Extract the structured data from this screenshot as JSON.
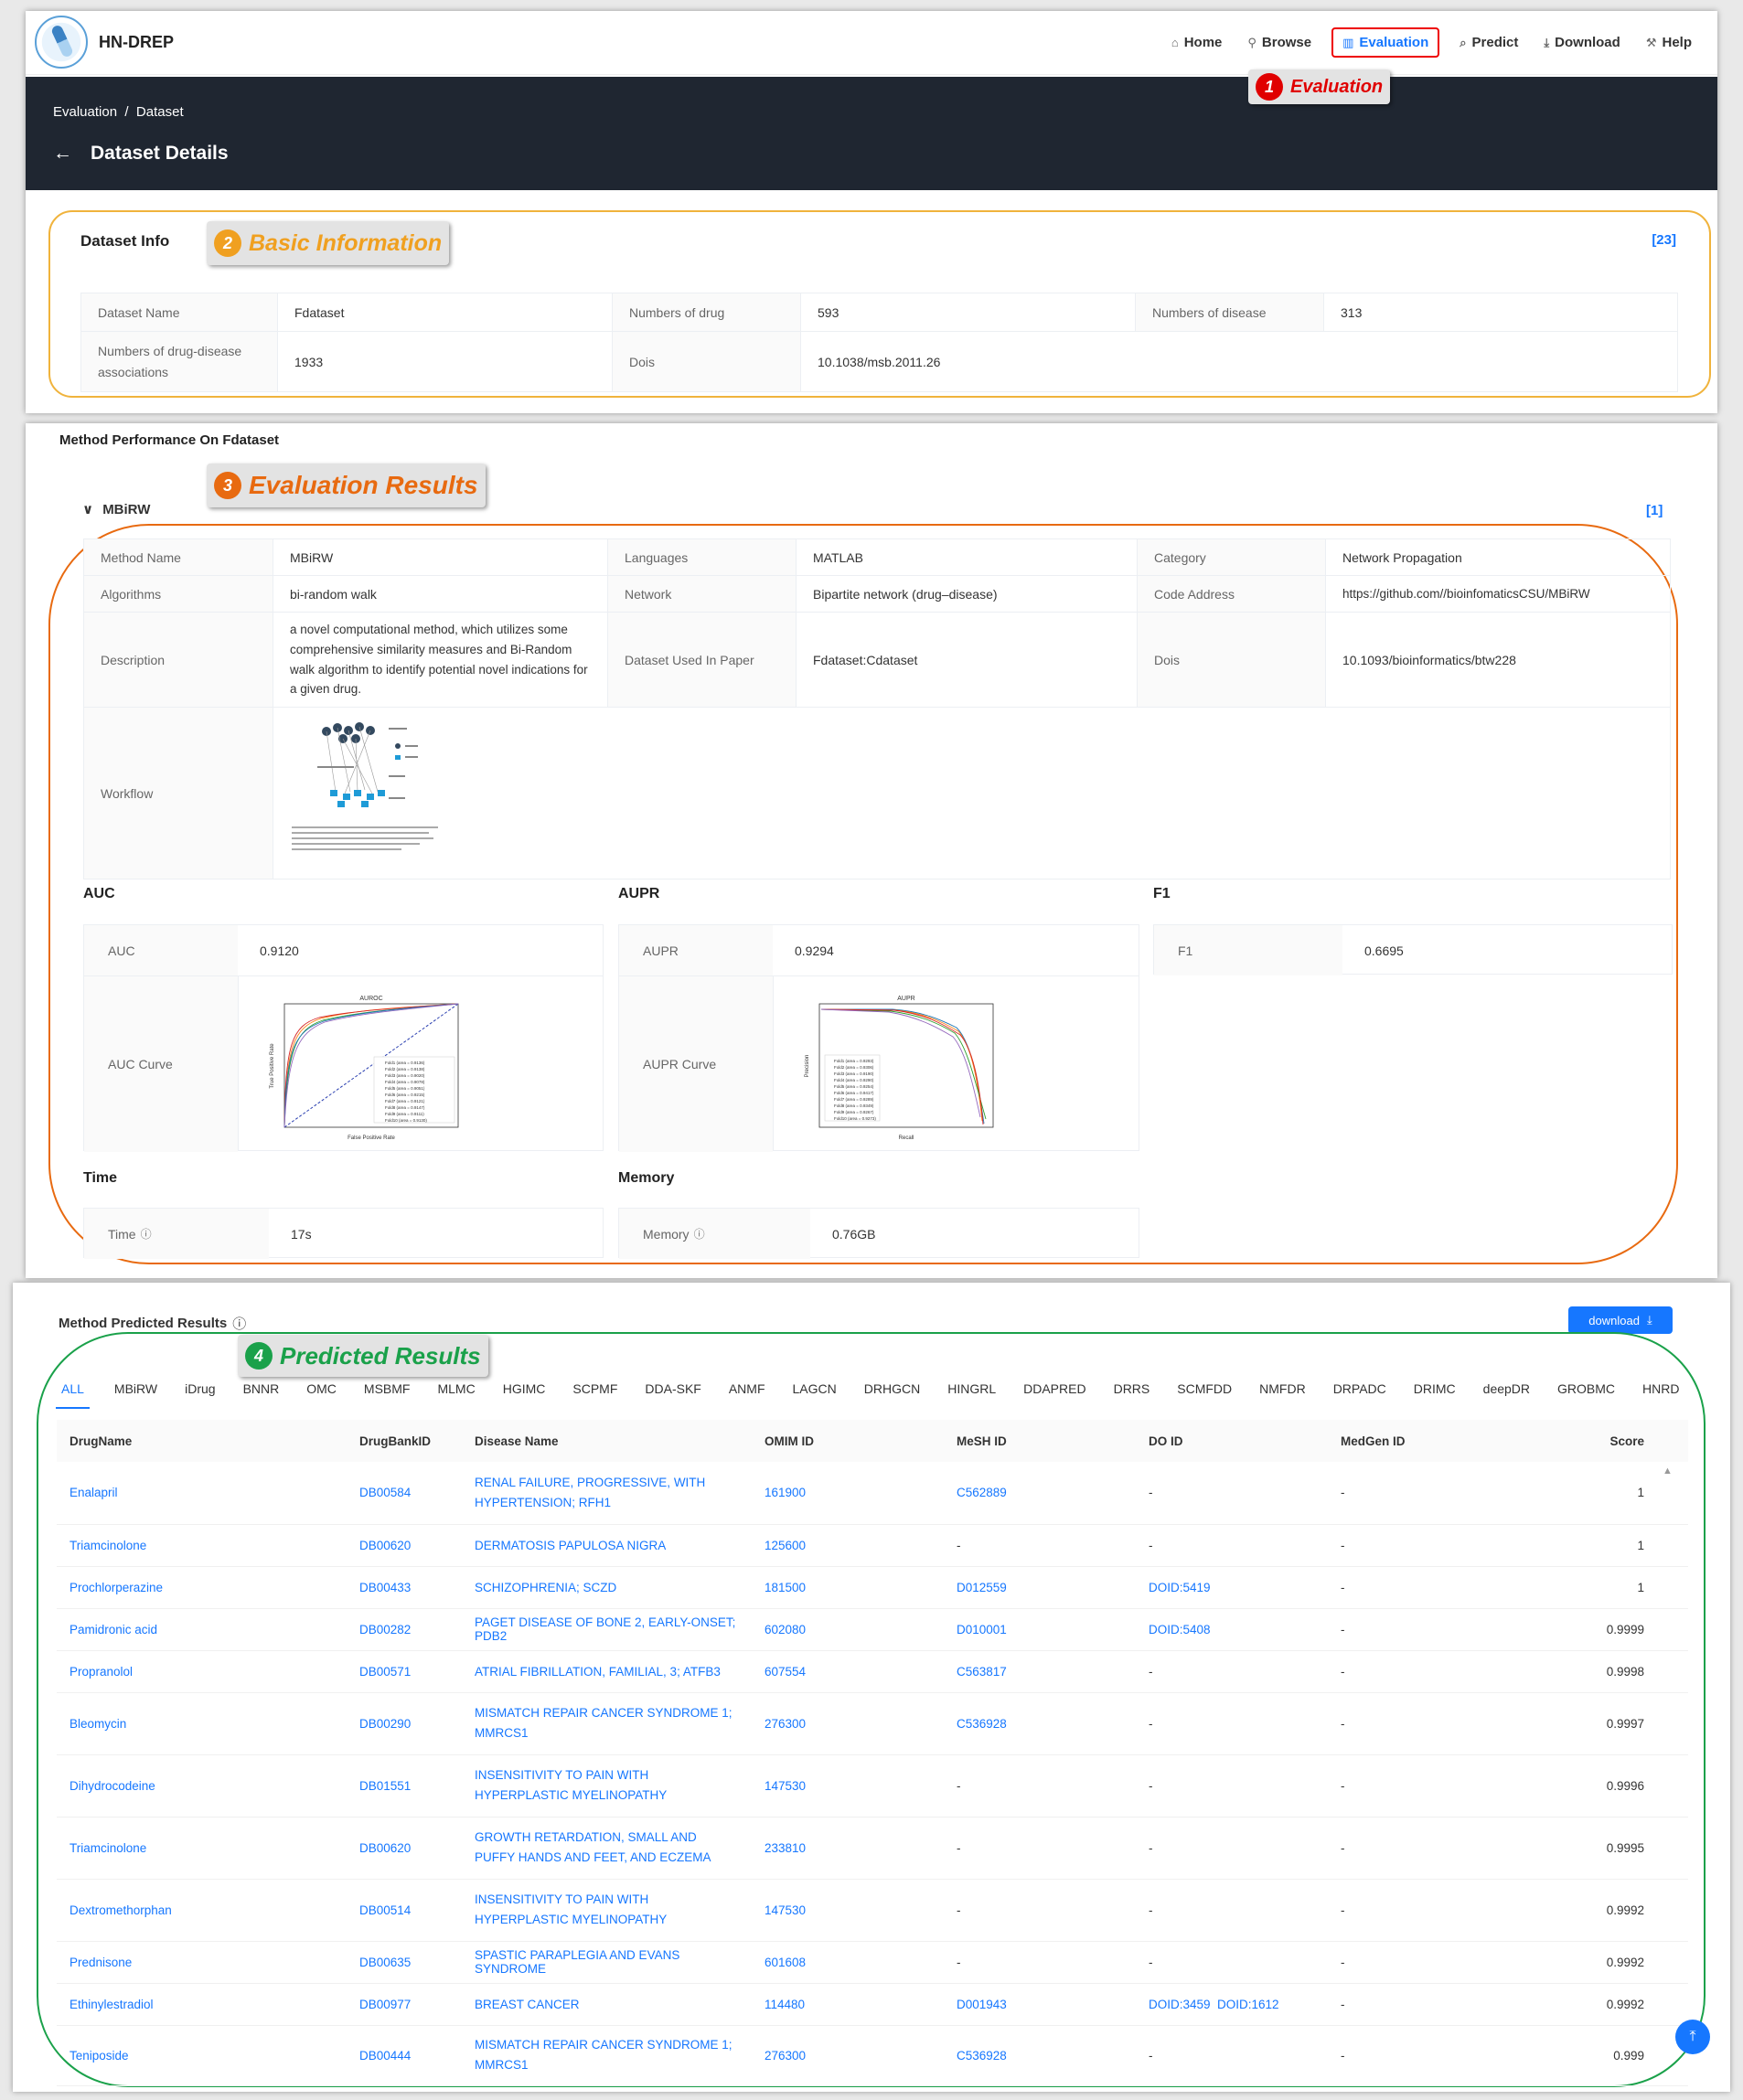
{
  "brand": "HN-DREP",
  "nav": [
    {
      "label": "Home",
      "icon": "home-icon"
    },
    {
      "label": "Browse",
      "icon": "browse-icon"
    },
    {
      "label": "Evaluation",
      "icon": "chart-icon"
    },
    {
      "label": "Predict",
      "icon": "search-icon"
    },
    {
      "label": "Download",
      "icon": "download-icon"
    },
    {
      "label": "Help",
      "icon": "wrench-icon"
    }
  ],
  "callouts": [
    {
      "num": "1",
      "text": "Evaluation",
      "color": "#e00000"
    },
    {
      "num": "2",
      "text": "Basic Information",
      "color": "#f0a020"
    },
    {
      "num": "3",
      "text": "Evaluation Results",
      "color": "#e86a10"
    },
    {
      "num": "4",
      "text": "Predicted Results",
      "color": "#1aa14a"
    }
  ],
  "breadcrumb": {
    "a": "Evaluation",
    "sep": "/",
    "b": "Dataset"
  },
  "page_title": "Dataset Details",
  "dataset_info": {
    "title": "Dataset Info",
    "ref": "[23]",
    "name_label": "Dataset Name",
    "name": "Fdataset",
    "drug_label": "Numbers of drug",
    "drug": "593",
    "disease_label": "Numbers of disease",
    "disease": "313",
    "assoc_label": "Numbers of drug-disease associations",
    "assoc": "1933",
    "dois_label": "Dois",
    "dois": "10.1038/msb.2011.26"
  },
  "method_perf": {
    "title": "Method Performance On Fdataset",
    "method": "MBiRW",
    "ref": "[1]",
    "rows": {
      "method_name_label": "Method Name",
      "method_name": "MBiRW",
      "languages_label": "Languages",
      "languages": "MATLAB",
      "category_label": "Category",
      "category": "Network Propagation",
      "algorithms_label": "Algorithms",
      "algorithms": "bi-random walk",
      "network_label": "Network",
      "network": "Bipartite network (drug–disease)",
      "code_label": "Code Address",
      "code": "https://github.com//bioinfomaticsCSU/MBiRW",
      "description_label": "Description",
      "description": "a novel computational method, which utilizes some comprehensive similarity measures and Bi-Random walk algorithm to identify potential novel indications for a given drug.",
      "dataset_used_label": "Dataset Used In Paper",
      "dataset_used": "Fdataset:Cdataset",
      "dois_label": "Dois",
      "dois": "10.1093/bioinformatics/btw228",
      "workflow_label": "Workflow"
    },
    "auc": {
      "title": "AUC",
      "label": "AUC",
      "value": "0.9120",
      "curve_label": "AUC Curve",
      "chart_title": "AUROC",
      "xlabel": "False Positive Rate",
      "ylabel": "True Positive Rate"
    },
    "aupr": {
      "title": "AUPR",
      "label": "AUPR",
      "value": "0.9294",
      "curve_label": "AUPR Curve",
      "chart_title": "AUPR",
      "xlabel": "Recall",
      "ylabel": "Precision"
    },
    "f1": {
      "title": "F1",
      "label": "F1",
      "value": "0.6695"
    },
    "time": {
      "title": "Time",
      "label": "Time",
      "value": "17s"
    },
    "memory": {
      "title": "Memory",
      "label": "Memory",
      "value": "0.76GB"
    }
  },
  "predicted": {
    "title": "Method Predicted Results",
    "download": "download",
    "tabs": [
      "ALL",
      "MBiRW",
      "iDrug",
      "BNNR",
      "OMC",
      "MSBMF",
      "MLMC",
      "HGIMC",
      "SCPMF",
      "DDA-SKF",
      "ANMF",
      "LAGCN",
      "DRHGCN",
      "HINGRL",
      "DDAPRED",
      "DRRS",
      "SCMFDD",
      "NMFDR",
      "DRPADC",
      "DRIMC",
      "deepDR",
      "GROBMC",
      "HNRD"
    ],
    "columns": [
      "DrugName",
      "DrugBankID",
      "Disease Name",
      "OMIM ID",
      "MeSH ID",
      "DO ID",
      "MedGen ID",
      "Score"
    ],
    "rows": [
      [
        "Enalapril",
        "DB00584",
        "RENAL FAILURE, PROGRESSIVE, WITH HYPERTENSION; RFH1",
        "161900",
        "C562889",
        "-",
        "-",
        "1"
      ],
      [
        "Triamcinolone",
        "DB00620",
        "DERMATOSIS PAPULOSA NIGRA",
        "125600",
        "-",
        "-",
        "-",
        "1"
      ],
      [
        "Prochlorperazine",
        "DB00433",
        "SCHIZOPHRENIA; SCZD",
        "181500",
        "D012559",
        "DOID:5419",
        "-",
        "1"
      ],
      [
        "Pamidronic acid",
        "DB00282",
        "PAGET DISEASE OF BONE 2, EARLY-ONSET; PDB2",
        "602080",
        "D010001",
        "DOID:5408",
        "-",
        "0.9999"
      ],
      [
        "Propranolol",
        "DB00571",
        "ATRIAL FIBRILLATION, FAMILIAL, 3; ATFB3",
        "607554",
        "C563817",
        "-",
        "-",
        "0.9998"
      ],
      [
        "Bleomycin",
        "DB00290",
        "MISMATCH REPAIR CANCER SYNDROME 1; MMRCS1",
        "276300",
        "C536928",
        "-",
        "-",
        "0.9997"
      ],
      [
        "Dihydrocodeine",
        "DB01551",
        "INSENSITIVITY TO PAIN WITH HYPERPLASTIC MYELINOPATHY",
        "147530",
        "-",
        "-",
        "-",
        "0.9996"
      ],
      [
        "Triamcinolone",
        "DB00620",
        "GROWTH RETARDATION, SMALL AND PUFFY HANDS AND FEET, AND ECZEMA",
        "233810",
        "-",
        "-",
        "-",
        "0.9995"
      ],
      [
        "Dextromethorphan",
        "DB00514",
        "INSENSITIVITY TO PAIN WITH HYPERPLASTIC MYELINOPATHY",
        "147530",
        "-",
        "-",
        "-",
        "0.9992"
      ],
      [
        "Prednisone",
        "DB00635",
        "SPASTIC PARAPLEGIA AND EVANS SYNDROME",
        "601608",
        "-",
        "-",
        "-",
        "0.9992"
      ],
      [
        "Ethinylestradiol",
        "DB00977",
        "BREAST CANCER",
        "114480",
        "D001943",
        "DOID:3459  DOID:1612",
        "-",
        "0.9992"
      ],
      [
        "Teniposide",
        "DB00444",
        "MISMATCH REPAIR CANCER SYNDROME 1; MMRCS1",
        "276300",
        "C536928",
        "-",
        "-",
        "0.999"
      ]
    ]
  },
  "colors": {
    "accent": "#1677ff",
    "dark_header": "#1f2631",
    "info_border": "#f0b33c",
    "eval_border": "#e86a10",
    "pred_border": "#1aa14a"
  }
}
